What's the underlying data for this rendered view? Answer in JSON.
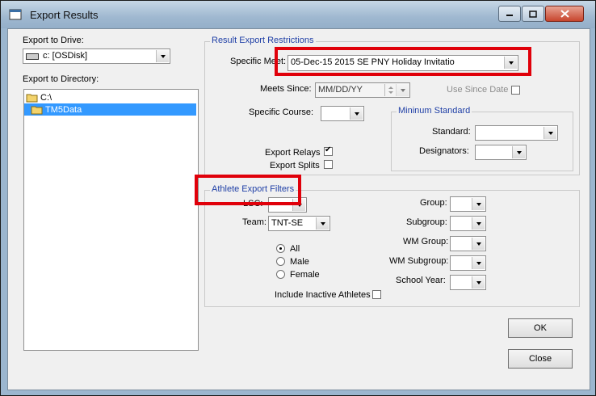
{
  "window": {
    "title": "Export Results"
  },
  "left": {
    "drive_label": "Export to Drive:",
    "drive_value": "c: [OSDisk]",
    "dir_label": "Export to Directory:",
    "dirs": [
      "C:\\",
      "TM5Data"
    ]
  },
  "restrictions": {
    "title": "Result Export Restrictions",
    "specific_meet_label": "Specific Meet:",
    "specific_meet_value": "05-Dec-15 2015 SE PNY Holiday Invitatio",
    "meets_since_label": "Meets Since:",
    "meets_since_value": "MM/DD/YY",
    "use_since_date_label": "Use Since Date",
    "specific_course_label": "Specific Course:",
    "min_standard_title": "Mininum Standard",
    "standard_label": "Standard:",
    "designators_label": "Designators:",
    "export_relays_label": "Export Relays",
    "export_splits_label": "Export Splits"
  },
  "filters": {
    "title": "Athlete Export Filters",
    "lsc_label": "LSC:",
    "team_label": "Team:",
    "team_value": "TNT-SE",
    "radios": [
      "All",
      "Male",
      "Female"
    ],
    "include_inactive_label": "Include Inactive Athletes",
    "group_label": "Group:",
    "subgroup_label": "Subgroup:",
    "wm_group_label": "WM Group:",
    "wm_subgroup_label": "WM Subgroup:",
    "school_year_label": "School Year:"
  },
  "buttons": {
    "ok": "OK",
    "close": "Close"
  },
  "colors": {
    "highlight": "#e0000a",
    "group_title": "#1f3fa6",
    "selection": "#3399ff"
  }
}
